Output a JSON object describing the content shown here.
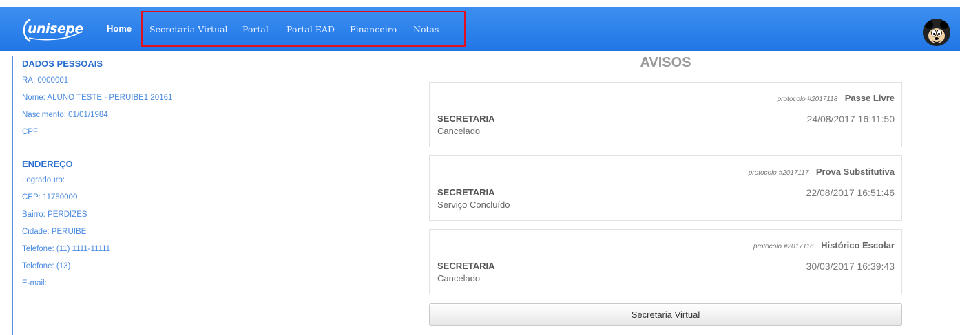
{
  "brand": {
    "logo_text": "unisepe"
  },
  "nav": {
    "items": [
      {
        "label": "Home"
      },
      {
        "label": "Secretaria Virtual"
      },
      {
        "label": "Portal"
      },
      {
        "label": "Portal EAD"
      },
      {
        "label": "Financeiro"
      },
      {
        "label": "Notas"
      }
    ]
  },
  "personal": {
    "title": "DADOS PESSOAIS",
    "ra": "RA: 0000001",
    "nome": "Nome: ALUNO TESTE - PERUIBE1 20161",
    "nascimento": "Nascimento: 01/01/1984",
    "cpf": "CPF"
  },
  "address": {
    "title": "ENDEREÇO",
    "logradouro": "Logradouro:",
    "cep": "CEP: 11750000",
    "bairro": "Bairro: PERDIZES",
    "cidade": "Cidade: PERUIBE",
    "telefone1": "Telefone: (11) 1111-11111",
    "telefone2": "Telefone: (13)",
    "email": "E-mail:"
  },
  "avisos": {
    "title": "AVISOS",
    "cards": [
      {
        "protocol": "protocolo #2017118",
        "title": "Passe Livre",
        "department": "SECRETARIA",
        "status": "Cancelado",
        "datetime": "24/08/2017 16:11:50"
      },
      {
        "protocol": "protocolo #2017117",
        "title": "Prova Substitutiva",
        "department": "SECRETARIA",
        "status": "Serviço Concluído",
        "datetime": "22/08/2017 16:51:46"
      },
      {
        "protocol": "protocolo #2017116",
        "title": "Histórico Escolar",
        "department": "SECRETARIA",
        "status": "Cancelado",
        "datetime": "30/03/2017 16:39:43"
      }
    ],
    "button_label": "Secretaria Virtual"
  },
  "colors": {
    "navbar": "#2a7de9",
    "highlight": "#e0101f",
    "link": "#4a8be0",
    "section_title": "#2a6fd0"
  },
  "icons": {
    "avatar": "mickey-avatar-icon"
  }
}
